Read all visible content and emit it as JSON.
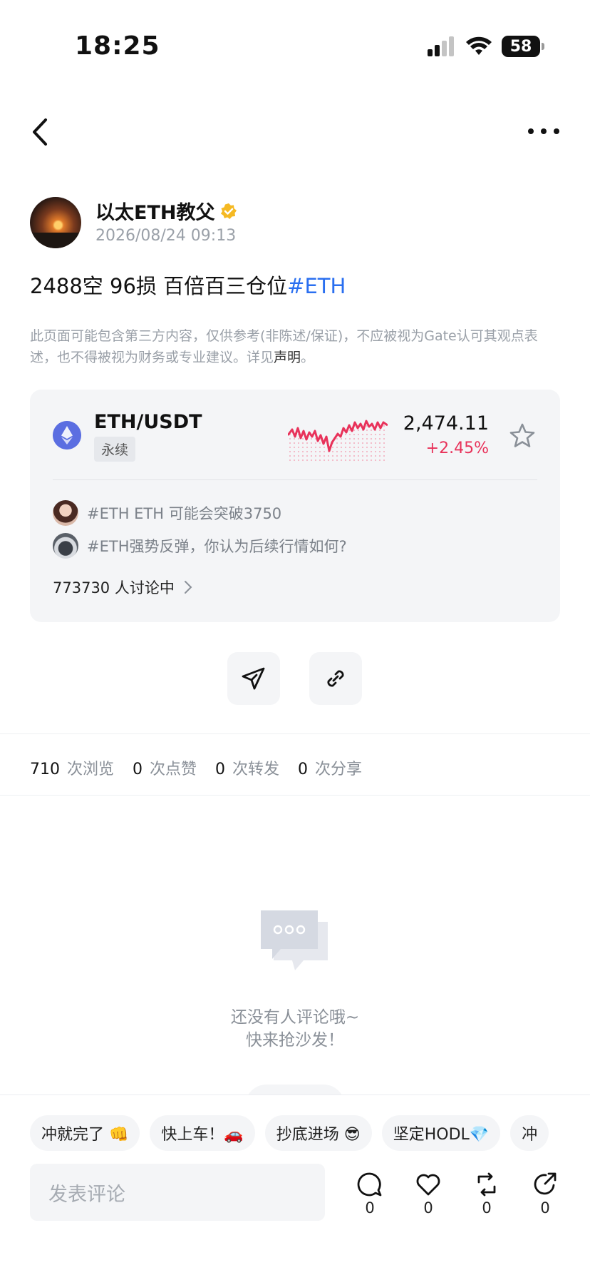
{
  "status_bar": {
    "time": "18:25",
    "battery": "58"
  },
  "author": {
    "name": "以太ETH教父",
    "timestamp": "2026/08/24 09:13"
  },
  "post": {
    "text": "2488空 96损 百倍百三仓位",
    "hashtag": "#ETH"
  },
  "disclaimer": {
    "text": "此页面可能包含第三方内容，仅供参考(非陈述/保证)，不应被视为Gate认可其观点表述，也不得被视为财务或专业建议。详见",
    "link": "声明",
    "end": "。"
  },
  "market_card": {
    "pair": "ETH/USDT",
    "tag": "永续",
    "price": "2,474.11",
    "change": "+2.45%",
    "topics": [
      "#ETH ETH 可能会突破3750",
      "#ETH强势反弹，你认为后续行情如何?"
    ],
    "discussion": "773730 人讨论中"
  },
  "stats": [
    {
      "num": "710",
      "label": "次浏览"
    },
    {
      "num": "0",
      "label": "次点赞"
    },
    {
      "num": "0",
      "label": "次转发"
    },
    {
      "num": "0",
      "label": "次分享"
    }
  ],
  "empty_state": {
    "line1": "还没有人评论哦~",
    "line2": "快来抢沙发！"
  },
  "quick_replies": [
    "冲就完了 👊",
    "快上车！🚗",
    "抄底进场 😎",
    "坚定HODL💎",
    "冲"
  ],
  "comment_input": {
    "placeholder": "发表评论"
  },
  "bottom_actions": [
    {
      "icon": "comment-icon",
      "count": "0"
    },
    {
      "icon": "heart-icon",
      "count": "0"
    },
    {
      "icon": "repost-icon",
      "count": "0"
    },
    {
      "icon": "share-icon",
      "count": "0"
    }
  ],
  "colors": {
    "accent": "#2a6ff0",
    "up": "#e8325a",
    "verified": "#f5b923",
    "eth": "#5b6ee1"
  }
}
